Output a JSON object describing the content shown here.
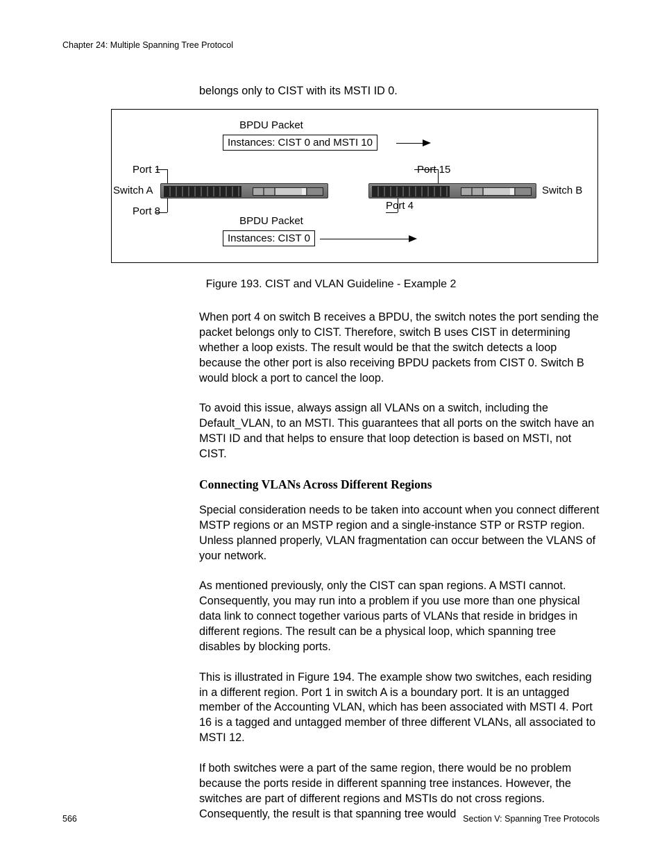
{
  "header": {
    "chapter_line": "Chapter 24: Multiple Spanning Tree Protocol"
  },
  "lead_in": "belongs only to CIST with its MSTI ID 0.",
  "figure": {
    "bpdu_top_label": "BPDU Packet",
    "bpdu_top_box": "Instances: CIST 0 and MSTI 10",
    "bpdu_bot_label": "BPDU Packet",
    "bpdu_bot_box": "Instances: CIST 0",
    "port1": "Port 1",
    "port8": "Port 8",
    "port15": "Port 15",
    "port4": "Port 4",
    "switchA": "Switch A",
    "switchB": "Switch B",
    "caption": "Figure 193. CIST and VLAN Guideline - Example 2"
  },
  "paragraphs": {
    "p1": "When port 4 on switch B receives a BPDU, the switch notes the port sending the packet belongs only to CIST. Therefore, switch B uses CIST in determining whether a loop exists. The result would be that the switch detects a loop because the other port is also receiving BPDU packets from CIST 0. Switch B would block a port to cancel the loop.",
    "p2": "To avoid this issue, always assign all VLANs on a switch, including the Default_VLAN, to an MSTI. This guarantees that all ports on the switch have an MSTI ID and that helps to ensure that loop detection is based on MSTI, not CIST.",
    "subhead": "Connecting VLANs Across Different Regions",
    "p3": "Special consideration needs to be taken into account when you connect different MSTP regions or an MSTP region and a single-instance STP or RSTP region. Unless planned properly, VLAN fragmentation can occur between the VLANS of your network.",
    "p4": "As mentioned previously, only the CIST can span regions. A MSTI cannot. Consequently, you may run into a problem if you use more than one physical data link to connect together various parts of VLANs that reside in bridges in different regions. The result can be a physical loop, which spanning tree disables by blocking ports.",
    "p5": "This is illustrated in Figure 194. The example show two switches, each residing in a different region. Port 1 in switch A is a boundary port. It is an untagged member of the Accounting VLAN, which has been associated with MSTI 4. Port 16 is a tagged and untagged member of three different VLANs, all associated to MSTI 12.",
    "p6": "If both switches were a part of the same region, there would be no problem because the ports reside in different spanning tree instances. However, the switches are part of different regions and MSTIs do not cross regions. Consequently, the result is that spanning tree would"
  },
  "footer": {
    "page_no": "566",
    "section": "Section V: Spanning Tree Protocols"
  }
}
